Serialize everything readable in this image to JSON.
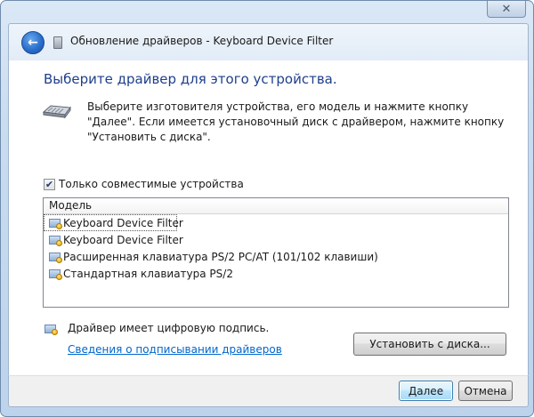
{
  "window": {
    "close_glyph": "✕",
    "title": "Обновление драйверов - Keyboard Device Filter"
  },
  "nav": {
    "back_glyph": "←"
  },
  "main": {
    "heading": "Выберите драйвер для этого устройства.",
    "intro": "Выберите изготовителя устройства, его модель и нажмите кнопку \"Далее\". Если имеется установочный диск с  драйвером, нажмите кнопку \"Установить с диска\".",
    "compat_checkbox": {
      "label": "Только совместимые устройства",
      "checked": true,
      "glyph": "✔"
    },
    "list": {
      "header": "Модель",
      "items": [
        {
          "label": "Keyboard Device Filter",
          "selected": true
        },
        {
          "label": "Keyboard Device Filter",
          "selected": false
        },
        {
          "label": "Расширенная клавиатура PS/2 PC/AT (101/102 клавиши)",
          "selected": false
        },
        {
          "label": "Стандартная клавиатура PS/2",
          "selected": false
        }
      ]
    },
    "signature_text": "Драйвер имеет цифровую подпись.",
    "signature_link": "Сведения о подписывании драйверов",
    "have_disk_button": "Установить с диска..."
  },
  "footer": {
    "next_button": "Далее",
    "cancel_button": "Отмена"
  },
  "icons": {
    "back": "back-arrow-icon",
    "title": "device-manager-icon",
    "keyboard": "keyboard-icon",
    "driver": "driver-certificate-icon",
    "close": "close-icon"
  },
  "colors": {
    "heading": "#1e3f8c",
    "link": "#0066cc",
    "frame": "#c9dcf0",
    "default_button_border": "#3c7fb1"
  }
}
